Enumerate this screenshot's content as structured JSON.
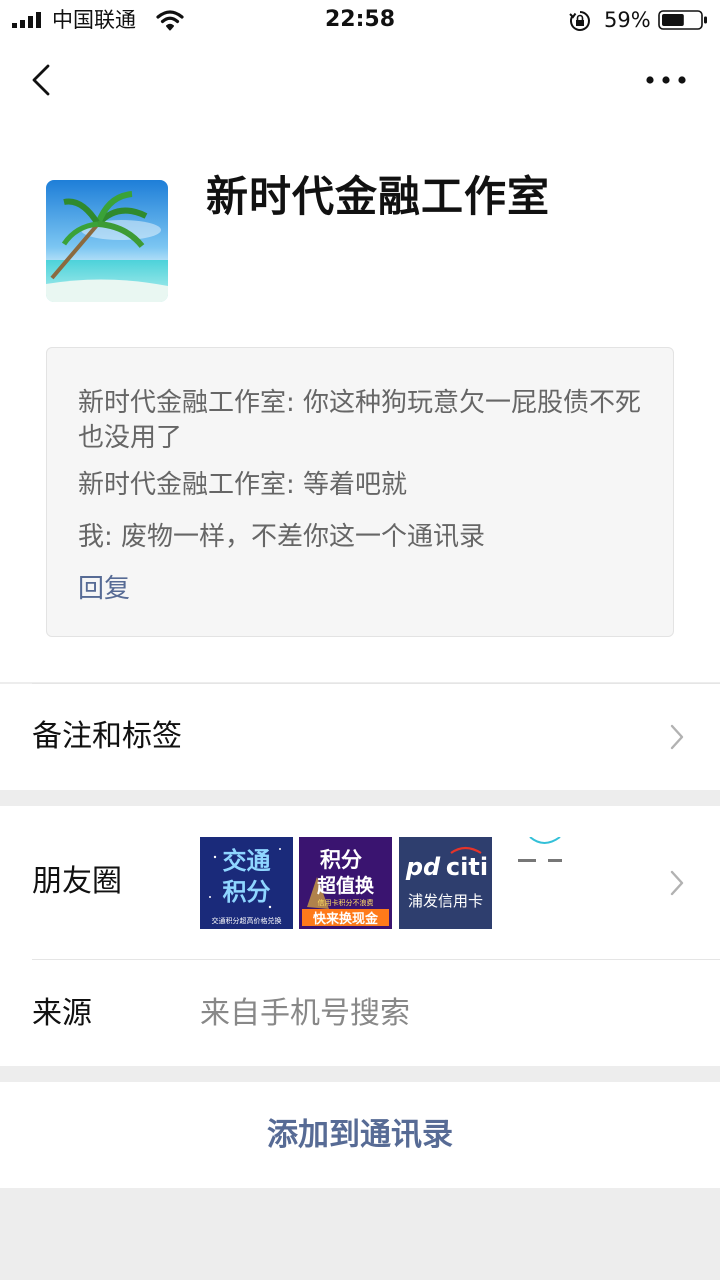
{
  "status_bar": {
    "carrier": "中国联通",
    "time": "22:58",
    "battery_percent": "59%",
    "battery_level": 0.59
  },
  "nav": {
    "back_icon": "chevron-left-icon",
    "more_icon": "ellipsis-icon"
  },
  "profile": {
    "name": "新时代金融工作室",
    "avatar": "palm-tree-beach-avatar"
  },
  "messages": [
    {
      "text": "新时代金融工作室: 你这种狗玩意欠一屁股债不死也没用了"
    },
    {
      "text": "新时代金融工作室: 等着吧就"
    },
    {
      "text": "我: 废物一样，不差你这一个通讯录"
    }
  ],
  "reply_label": "回复",
  "rows": {
    "remark": {
      "label": "备注和标签"
    },
    "moments": {
      "label": "朋友圈",
      "thumbs": [
        {
          "line1": "交通",
          "line2": "积分",
          "caption": "交通积分超高价格兑换"
        },
        {
          "line1": "积分",
          "line2": "超值换",
          "small": "信用卡积分不浪费",
          "caption": "快来换现金"
        },
        {
          "logo_left": "pd",
          "logo_right": "citi",
          "caption": "浦发信用卡"
        },
        {
          "caption": ""
        }
      ]
    },
    "source": {
      "label": "来源",
      "value": "来自手机号搜索"
    }
  },
  "action": {
    "label": "添加到通讯录"
  },
  "colors": {
    "link": "#576b95",
    "background": "#ededed"
  }
}
